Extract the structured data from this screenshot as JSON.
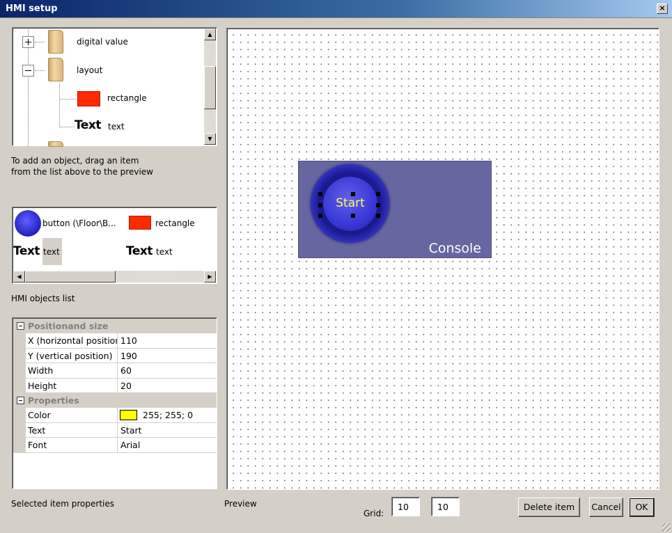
{
  "window": {
    "title": "HMI setup",
    "close_glyph": "×"
  },
  "tree": {
    "items": [
      {
        "label": "digital value",
        "expander": "plus"
      },
      {
        "label": "layout",
        "expander": "minus"
      },
      {
        "label": "rectangle"
      },
      {
        "label": "text",
        "preview_text": "Text"
      }
    ]
  },
  "hint_text": "To add an object, drag an item from the list above to the preview",
  "objects_list": {
    "caption": "HMI objects list",
    "items": [
      {
        "label": "button (\\Floor\\B..."
      },
      {
        "label": "rectangle"
      },
      {
        "label": "text",
        "preview_text": "Text"
      },
      {
        "label": "text",
        "preview_text": "Text"
      }
    ]
  },
  "properties": {
    "caption": "Selected item properties",
    "categories": [
      {
        "title": "Positionand size",
        "rows": [
          {
            "name": "X (horizontal position)",
            "value": "110"
          },
          {
            "name": "Y (vertical position)",
            "value": "190"
          },
          {
            "name": "Width",
            "value": "60"
          },
          {
            "name": "Height",
            "value": "20"
          }
        ]
      },
      {
        "title": "Properties",
        "rows": [
          {
            "name": "Color",
            "value": "255; 255; 0",
            "swatch": "#ffff00"
          },
          {
            "name": "Text",
            "value": "Start"
          },
          {
            "name": "Font",
            "value": "Arial"
          }
        ]
      }
    ]
  },
  "preview": {
    "caption": "Preview",
    "console_label": "Console",
    "button_text": "Start"
  },
  "grid": {
    "label": "Grid:",
    "x": "10",
    "y": "10"
  },
  "buttons": {
    "delete": "Delete item",
    "cancel": "Cancel",
    "ok": "OK"
  },
  "colors": {
    "console_bg": "#6666a0",
    "button_blue": "#3838d8",
    "start_text": "#ffff60",
    "rect_red": "#ff2a00"
  }
}
